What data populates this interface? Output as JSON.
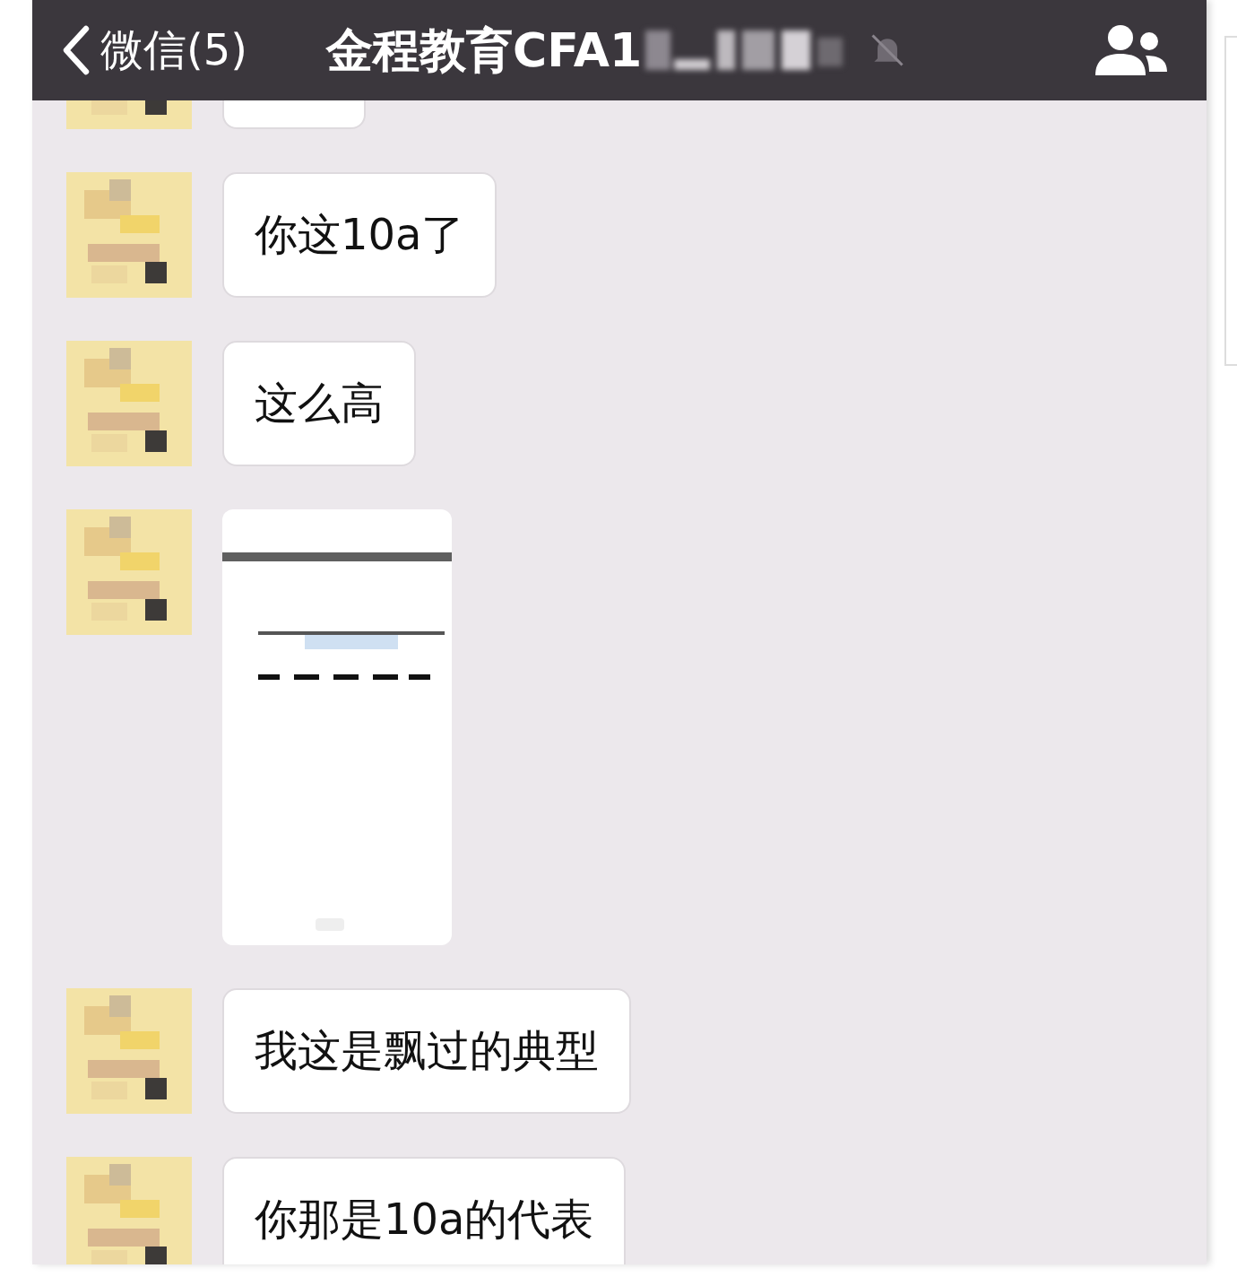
{
  "header": {
    "back_label": "微信(5)",
    "title": "金程教育CFA1",
    "muted": true
  },
  "messages": [
    {
      "kind": "text"
    },
    {
      "kind": "text",
      "text": "你这10a了"
    },
    {
      "kind": "text",
      "text": "这么高"
    },
    {
      "kind": "picture"
    },
    {
      "kind": "text",
      "text": "我这是飘过的典型"
    },
    {
      "kind": "text",
      "text": "你那是10a的代表"
    }
  ]
}
